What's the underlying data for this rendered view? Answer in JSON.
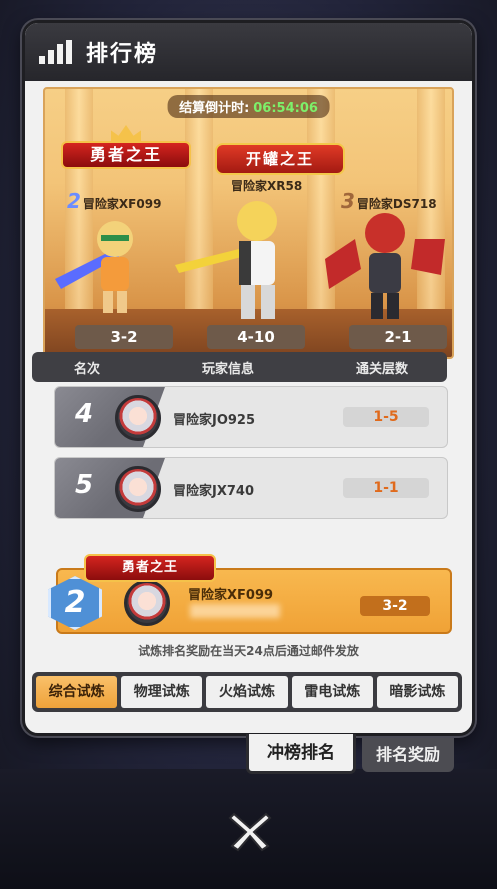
{
  "panel": {
    "title": "排行榜"
  },
  "podium": {
    "timer_label": "结算倒计时:",
    "timer_value": "06:54:06",
    "brave_badge": "勇者之王",
    "king_badge": "开罐之王",
    "first": {
      "name": "冒险家XR58",
      "score": "4-10"
    },
    "second": {
      "rank": "2",
      "name": "冒险家XF099",
      "score": "3-2"
    },
    "third": {
      "rank": "3",
      "name": "冒险家DS718",
      "score": "2-1"
    }
  },
  "table": {
    "headers": [
      "名次",
      "玩家信息",
      "通关层数"
    ],
    "rows": [
      {
        "rank": "4",
        "name": "冒险家JO925",
        "floor": "1-5"
      },
      {
        "rank": "5",
        "name": "冒险家JX740",
        "floor": "1-1"
      }
    ]
  },
  "mine": {
    "badge": "勇者之王",
    "rank": "2",
    "name": "冒险家XF099",
    "floor": "3-2"
  },
  "note": "试炼排名奖励在当天24点后通过邮件发放",
  "tabs": [
    "综合试炼",
    "物理试炼",
    "火焰试炼",
    "雷电试炼",
    "暗影试炼"
  ],
  "bottom_tabs": {
    "rank": "冲榜排名",
    "reward": "排名奖励"
  },
  "colors": {
    "accent": "#f0a236",
    "timer": "#7df06a",
    "floor_text": "#e06a1c"
  }
}
